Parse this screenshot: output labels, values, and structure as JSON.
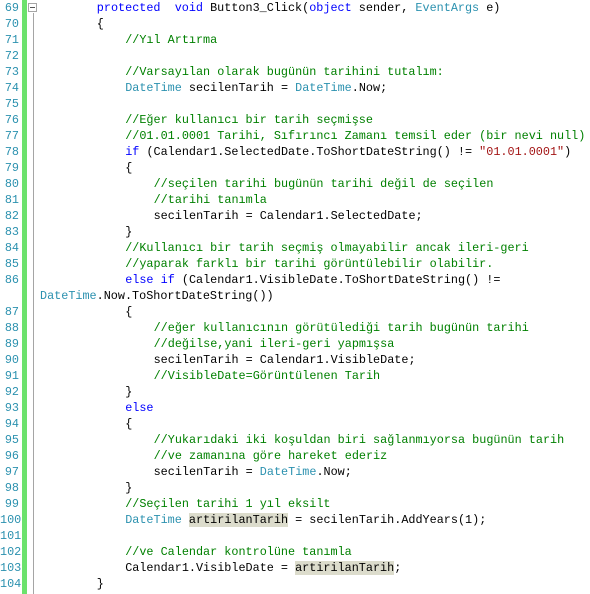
{
  "editor": {
    "colors": {
      "keyword": "#0000ff",
      "type": "#2b91af",
      "comment": "#008000",
      "string": "#a31515",
      "line_number": "#2b91af",
      "changed_bar": "#6ce26c",
      "highlight": "#dcdccc"
    },
    "fold_icon": "collapse-minus-icon",
    "lines": [
      {
        "n": "69",
        "indent": 8,
        "tokens": [
          [
            "kw",
            "protected"
          ],
          [
            "",
            "  "
          ],
          [
            "kw",
            "void"
          ],
          [
            "",
            " Button3_Click("
          ],
          [
            "kw",
            "object"
          ],
          [
            "",
            " sender, "
          ],
          [
            "ty",
            "EventArgs"
          ],
          [
            "",
            " e)"
          ]
        ]
      },
      {
        "n": "70",
        "indent": 8,
        "tokens": [
          [
            "",
            "{"
          ]
        ]
      },
      {
        "n": "71",
        "indent": 12,
        "tokens": [
          [
            "cm",
            "//Yıl Artırma"
          ]
        ]
      },
      {
        "n": "72",
        "indent": 0,
        "tokens": []
      },
      {
        "n": "73",
        "indent": 12,
        "tokens": [
          [
            "cm",
            "//Varsayılan olarak bugünün tarihini tutalım:"
          ]
        ]
      },
      {
        "n": "74",
        "indent": 12,
        "tokens": [
          [
            "ty",
            "DateTime"
          ],
          [
            "",
            " secilenTarih = "
          ],
          [
            "ty",
            "DateTime"
          ],
          [
            "",
            ".Now;"
          ]
        ]
      },
      {
        "n": "75",
        "indent": 0,
        "tokens": []
      },
      {
        "n": "76",
        "indent": 12,
        "tokens": [
          [
            "cm",
            "//Eğer kullanıcı bir tarih seçmişse"
          ]
        ]
      },
      {
        "n": "77",
        "indent": 12,
        "tokens": [
          [
            "cm",
            "//01.01.0001 Tarihi, Sıfırıncı Zamanı temsil eder (bir nevi null)"
          ]
        ]
      },
      {
        "n": "78",
        "indent": 12,
        "tokens": [
          [
            "kw",
            "if"
          ],
          [
            "",
            " (Calendar1.SelectedDate.ToShortDateString() != "
          ],
          [
            "st",
            "\"01.01.0001\""
          ],
          [
            "",
            ")"
          ]
        ]
      },
      {
        "n": "79",
        "indent": 12,
        "tokens": [
          [
            "",
            "{"
          ]
        ]
      },
      {
        "n": "80",
        "indent": 16,
        "tokens": [
          [
            "cm",
            "//seçilen tarihi bugünün tarihi değil de seçilen"
          ]
        ]
      },
      {
        "n": "81",
        "indent": 16,
        "tokens": [
          [
            "cm",
            "//tarihi tanımla"
          ]
        ]
      },
      {
        "n": "82",
        "indent": 16,
        "tokens": [
          [
            "",
            "secilenTarih = Calendar1.SelectedDate;"
          ]
        ]
      },
      {
        "n": "83",
        "indent": 12,
        "tokens": [
          [
            "",
            "}"
          ]
        ]
      },
      {
        "n": "84",
        "indent": 12,
        "tokens": [
          [
            "cm",
            "//Kullanıcı bir tarih seçmiş olmayabilir ancak ileri-geri"
          ]
        ]
      },
      {
        "n": "85",
        "indent": 12,
        "tokens": [
          [
            "cm",
            "//yaparak farklı bir tarihi görüntülebilir olabilir."
          ]
        ]
      },
      {
        "n": "86",
        "indent": 12,
        "tokens": [
          [
            "kw",
            "else"
          ],
          [
            "",
            " "
          ],
          [
            "kw",
            "if"
          ],
          [
            "",
            " (Calendar1.VisibleDate.ToShortDateString() !="
          ]
        ]
      },
      {
        "n": "",
        "indent": 0,
        "tokens": [
          [
            "ty",
            "DateTime"
          ],
          [
            "",
            ".Now.ToShortDateString())"
          ]
        ]
      },
      {
        "n": "87",
        "indent": 12,
        "tokens": [
          [
            "",
            "{"
          ]
        ]
      },
      {
        "n": "88",
        "indent": 16,
        "tokens": [
          [
            "cm",
            "//eğer kullanıcının görütülediği tarih bugünün tarihi"
          ]
        ]
      },
      {
        "n": "89",
        "indent": 16,
        "tokens": [
          [
            "cm",
            "//değilse,yani ileri-geri yapmışsa"
          ]
        ]
      },
      {
        "n": "90",
        "indent": 16,
        "tokens": [
          [
            "",
            "secilenTarih = Calendar1.VisibleDate;"
          ]
        ]
      },
      {
        "n": "91",
        "indent": 16,
        "tokens": [
          [
            "cm",
            "//VisibleDate=Görüntülenen Tarih"
          ]
        ]
      },
      {
        "n": "92",
        "indent": 12,
        "tokens": [
          [
            "",
            "}"
          ]
        ]
      },
      {
        "n": "93",
        "indent": 12,
        "tokens": [
          [
            "kw",
            "else"
          ]
        ]
      },
      {
        "n": "94",
        "indent": 12,
        "tokens": [
          [
            "",
            "{"
          ]
        ]
      },
      {
        "n": "95",
        "indent": 16,
        "tokens": [
          [
            "cm",
            "//Yukarıdaki iki koşuldan biri sağlanmıyorsa bugünün tarih"
          ]
        ]
      },
      {
        "n": "96",
        "indent": 16,
        "tokens": [
          [
            "cm",
            "//ve zamanına göre hareket ederiz"
          ]
        ]
      },
      {
        "n": "97",
        "indent": 16,
        "tokens": [
          [
            "",
            "secilenTarih = "
          ],
          [
            "ty",
            "DateTime"
          ],
          [
            "",
            ".Now;"
          ]
        ]
      },
      {
        "n": "98",
        "indent": 12,
        "tokens": [
          [
            "",
            "}"
          ]
        ]
      },
      {
        "n": "99",
        "indent": 12,
        "tokens": [
          [
            "cm",
            "//Seçilen tarihi 1 yıl eksilt"
          ]
        ]
      },
      {
        "n": "100",
        "indent": 12,
        "tokens": [
          [
            "ty",
            "DateTime"
          ],
          [
            "",
            " "
          ],
          [
            "hl",
            "artirilanTarih"
          ],
          [
            "",
            " = secilenTarih.AddYears(1);"
          ]
        ]
      },
      {
        "n": "101",
        "indent": 0,
        "tokens": []
      },
      {
        "n": "102",
        "indent": 12,
        "tokens": [
          [
            "cm",
            "//ve Calendar kontrolüne tanımla"
          ]
        ]
      },
      {
        "n": "103",
        "indent": 12,
        "tokens": [
          [
            "",
            "Calendar1.VisibleDate = "
          ],
          [
            "hl",
            "artirilanTarih"
          ],
          [
            "",
            ";"
          ]
        ]
      },
      {
        "n": "104",
        "indent": 8,
        "tokens": [
          [
            "",
            "}"
          ]
        ]
      }
    ]
  }
}
